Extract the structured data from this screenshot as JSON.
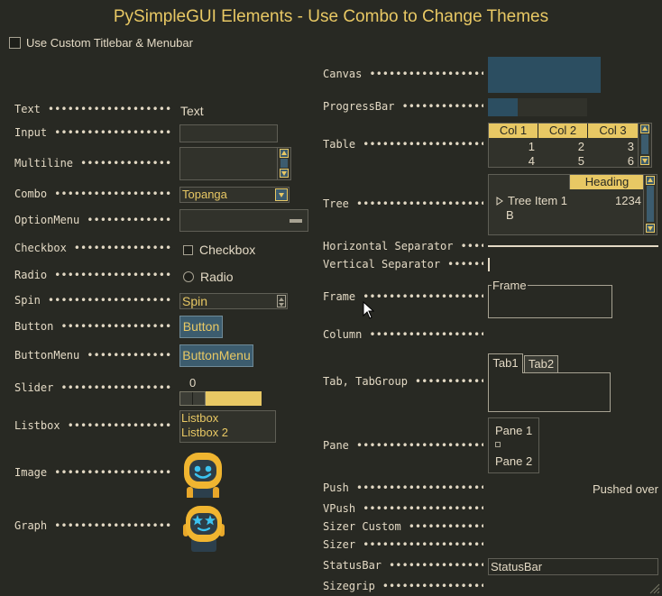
{
  "window": {
    "title": "PySimpleGUI Elements - Use Combo to Change Themes"
  },
  "custom_titlebar": {
    "label": "Use Custom Titlebar & Menubar",
    "checked": false
  },
  "left": {
    "rows": [
      {
        "key": "text",
        "label": "Text"
      },
      {
        "key": "input",
        "label": "Input"
      },
      {
        "key": "multiline",
        "label": "Multiline"
      },
      {
        "key": "combo",
        "label": "Combo"
      },
      {
        "key": "optionmenu",
        "label": "OptionMenu"
      },
      {
        "key": "checkbox",
        "label": "Checkbox"
      },
      {
        "key": "radio",
        "label": "Radio"
      },
      {
        "key": "spin",
        "label": "Spin"
      },
      {
        "key": "button",
        "label": "Button"
      },
      {
        "key": "buttonmenu",
        "label": "ButtonMenu"
      },
      {
        "key": "slider",
        "label": "Slider"
      },
      {
        "key": "listbox",
        "label": "Listbox"
      },
      {
        "key": "image",
        "label": "Image"
      },
      {
        "key": "graph",
        "label": "Graph"
      }
    ],
    "text_value": "Text",
    "input_value": "",
    "multiline_value": "",
    "combo_value": "Topanga",
    "optionmenu_value": "",
    "checkbox_label": "Checkbox",
    "radio_label": "Radio",
    "spin_value": "Spin",
    "button_label": "Button",
    "buttonmenu_label": "ButtonMenu",
    "slider_value": "0",
    "listbox_items": [
      "Listbox",
      "Listbox 2"
    ]
  },
  "right": {
    "rows": [
      {
        "key": "canvas",
        "label": "Canvas"
      },
      {
        "key": "progressbar",
        "label": "ProgressBar"
      },
      {
        "key": "table",
        "label": "Table"
      },
      {
        "key": "tree",
        "label": "Tree"
      },
      {
        "key": "hsep",
        "label": "Horizontal Separator"
      },
      {
        "key": "vsep",
        "label": "Vertical Separator"
      },
      {
        "key": "frame",
        "label": "Frame"
      },
      {
        "key": "column",
        "label": "Column"
      },
      {
        "key": "tabgroup",
        "label": "Tab, TabGroup"
      },
      {
        "key": "pane",
        "label": "Pane"
      },
      {
        "key": "push",
        "label": "Push"
      },
      {
        "key": "vpush",
        "label": "VPush"
      },
      {
        "key": "sizercustom",
        "label": "Sizer Custom"
      },
      {
        "key": "sizer",
        "label": "Sizer"
      },
      {
        "key": "statusbar",
        "label": "StatusBar"
      },
      {
        "key": "sizegrip",
        "label": "Sizegrip"
      }
    ],
    "progress_fraction": 0.3,
    "table": {
      "headers": [
        "Col 1",
        "Col 2",
        "Col 3"
      ],
      "rows": [
        [
          "1",
          "2",
          "3"
        ],
        [
          "4",
          "5",
          "6"
        ]
      ]
    },
    "tree": {
      "heading": "Heading",
      "item_label": "Tree Item 1",
      "item_value": "1234",
      "child_label": "B"
    },
    "frame_title": "Frame",
    "tabs": [
      "Tab1",
      "Tab2"
    ],
    "pane_items": [
      "Pane 1",
      "Pane 2"
    ],
    "push_text": "Pushed over",
    "statusbar_text": "StatusBar"
  },
  "colors": {
    "background": "#282923",
    "text": "#E3D9C4",
    "accent": "#E8C864",
    "button": "#3C5C6E",
    "input_bg": "#31322B"
  }
}
